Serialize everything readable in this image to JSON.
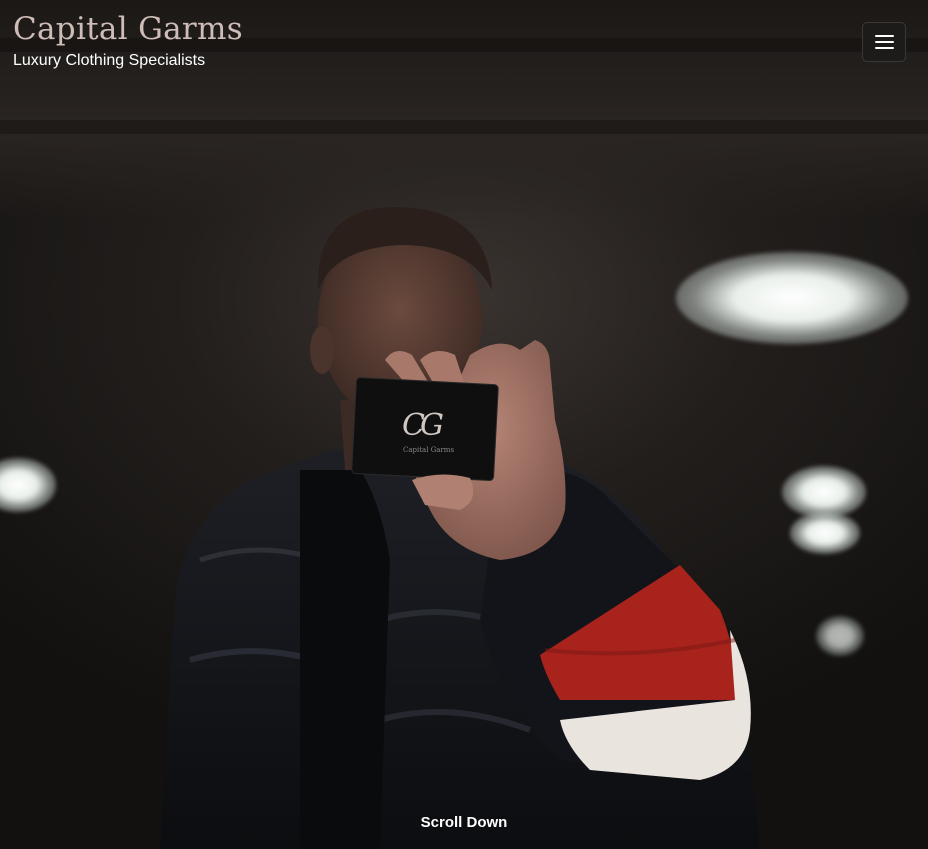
{
  "brand": {
    "title": "Capital Garms",
    "tagline": "Luxury Clothing Specialists"
  },
  "nav": {
    "menu_icon": "hamburger-menu-icon"
  },
  "hero": {
    "card_monogram": "CG",
    "card_text": "Capital Garms",
    "scroll_label": "Scroll Down"
  },
  "colors": {
    "brand_title": "#cdbdb6",
    "tagline": "#ffffff",
    "menu_button_bg": "#1c1b1a",
    "jacket": "#14151a",
    "sleeve_red": "#b1241c",
    "sleeve_white": "#e9e4de"
  }
}
